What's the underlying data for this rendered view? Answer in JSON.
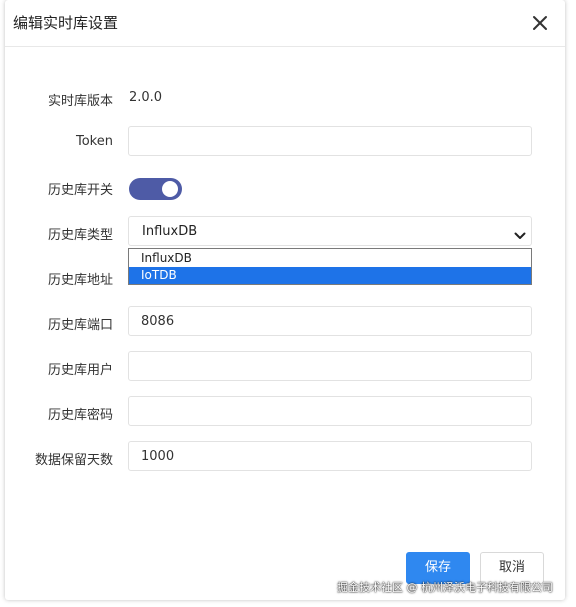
{
  "dialog": {
    "title": "编辑实时库设置"
  },
  "form": {
    "version": {
      "label": "实时库版本",
      "value": "2.0.0"
    },
    "token": {
      "label": "Token",
      "value": "",
      "placeholder": ""
    },
    "history_enabled": {
      "label": "历史库开关",
      "on": true
    },
    "history_type": {
      "label": "历史库类型",
      "selected": "InfluxDB",
      "options": [
        {
          "label": "InfluxDB",
          "highlighted": false
        },
        {
          "label": "IoTDB",
          "highlighted": true
        }
      ]
    },
    "history_address": {
      "label": "历史库地址",
      "value": ""
    },
    "history_port": {
      "label": "历史库端口",
      "value": "8086"
    },
    "history_user": {
      "label": "历史库用户",
      "value": ""
    },
    "history_password": {
      "label": "历史库密码",
      "value": ""
    },
    "retention_days": {
      "label": "数据保留天数",
      "value": "1000"
    }
  },
  "footer": {
    "save_label": "保存",
    "cancel_label": "取消"
  },
  "watermark": "掘金技术社区 @ 杭州泽沃电子科技有限公司",
  "colors": {
    "toggle_on": "#4e5ba6",
    "primary": "#2f88f0",
    "option_highlight": "#1e73e8"
  }
}
